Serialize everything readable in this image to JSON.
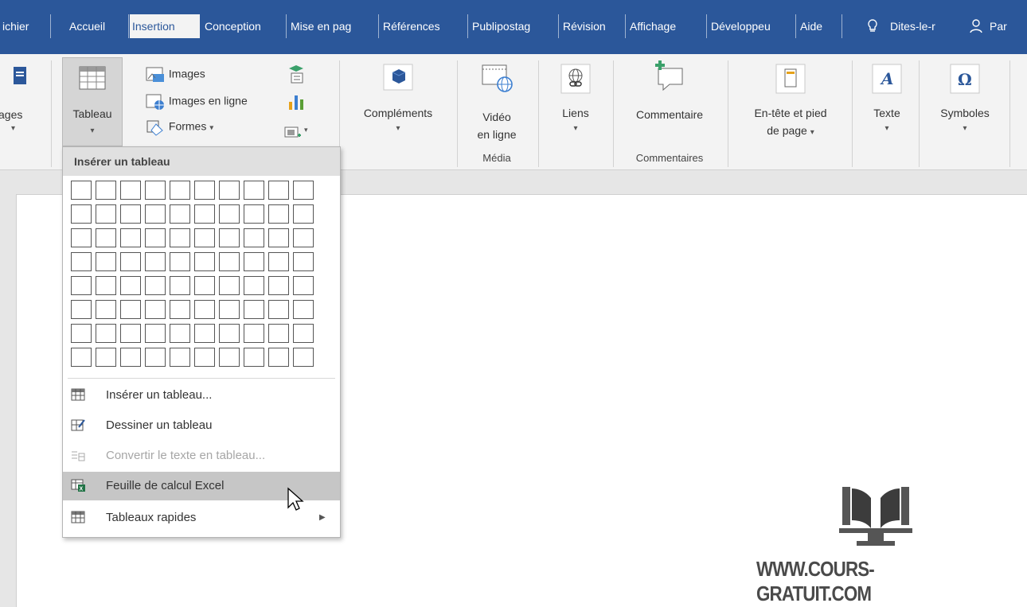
{
  "tabs": {
    "fichier": "ichier",
    "accueil": "Accueil",
    "insertion": "Insertion",
    "conception": "Conception",
    "mise_en_page": "Mise en pag",
    "references": "Références",
    "publipostage": "Publipostag",
    "revision": "Révision",
    "affichage": "Affichage",
    "developpeur": "Développeu",
    "aide": "Aide",
    "tell_me": "Dites-le-r",
    "share": "Par"
  },
  "ribbon": {
    "pages_label": "ages",
    "tableau_label": "Tableau",
    "images": "Images",
    "images_en_ligne": "Images en ligne",
    "formes": "Formes",
    "complements": "Compléments",
    "video_line1": "Vidéo",
    "video_line2": "en ligne",
    "liens": "Liens",
    "commentaire": "Commentaire",
    "entete_line1": "En-tête et pied",
    "entete_line2": "de page",
    "texte": "Texte",
    "symboles": "Symboles",
    "groups": {
      "media": "Média",
      "commentaires": "Commentaires"
    }
  },
  "dropdown": {
    "header": "Insérer un tableau",
    "grid": {
      "columns": 10,
      "rows": 8
    },
    "items": [
      {
        "label": "Insérer un tableau...",
        "icon": "table-icon",
        "state": "normal"
      },
      {
        "label": "Dessiner un tableau",
        "icon": "draw-table-icon",
        "state": "normal"
      },
      {
        "label": "Convertir le texte en tableau...",
        "icon": "convert-text-icon",
        "state": "disabled"
      },
      {
        "label": "Feuille de calcul Excel",
        "icon": "excel-sheet-icon",
        "state": "hover"
      },
      {
        "label": "Tableaux rapides",
        "icon": "quick-tables-icon",
        "state": "normal",
        "submenu": true
      }
    ]
  },
  "watermark": {
    "text": "WWW.COURS-GRATUIT.COM"
  },
  "colors": {
    "word_blue": "#2b579a",
    "ribbon_bg": "#f3f3f3",
    "hover_gray": "#c6c6c6",
    "disabled_text": "#a6a6a6"
  }
}
